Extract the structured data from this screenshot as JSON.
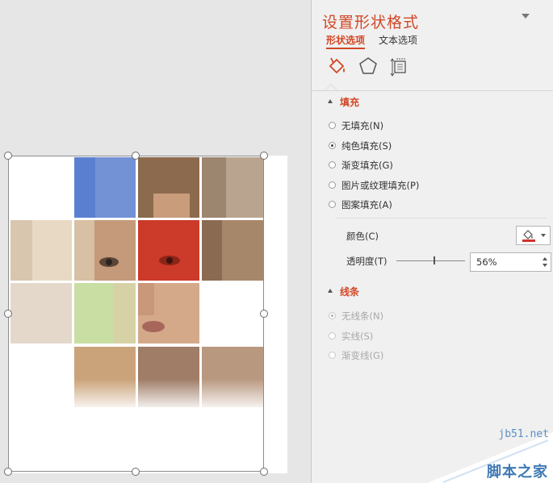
{
  "pane": {
    "title": "设置形状格式",
    "subtabs": [
      "形状选项",
      "文本选项"
    ],
    "icon_tabs": [
      "fill-line-icon",
      "effects-pentagon-icon",
      "size-properties-icon"
    ],
    "fill_section": {
      "heading": "填充",
      "options": [
        {
          "label": "无填充(N)",
          "selected": false
        },
        {
          "label": "纯色填充(S)",
          "selected": true
        },
        {
          "label": "渐变填充(G)",
          "selected": false
        },
        {
          "label": "图片或纹理填充(P)",
          "selected": false
        },
        {
          "label": "图案填充(A)",
          "selected": false
        }
      ],
      "color_label": "颜色(C)",
      "color_swatch": "#d0312d",
      "transparency_label": "透明度(T)",
      "transparency_value": "56%",
      "transparency_fraction": 0.56
    },
    "line_section": {
      "heading": "线条",
      "options": [
        {
          "label": "无线条(N)",
          "selected": true
        },
        {
          "label": "实线(S)",
          "selected": false
        },
        {
          "label": "渐变线(G)",
          "selected": false
        }
      ]
    }
  },
  "watermark": {
    "url": "jb51.net",
    "text": "脚本之家"
  },
  "colors": {
    "accent": "#d24726",
    "blue_overlay": "#5b7fd0",
    "red_overlay": "#cc3a2a",
    "green_overlay": "#c8dea3"
  }
}
